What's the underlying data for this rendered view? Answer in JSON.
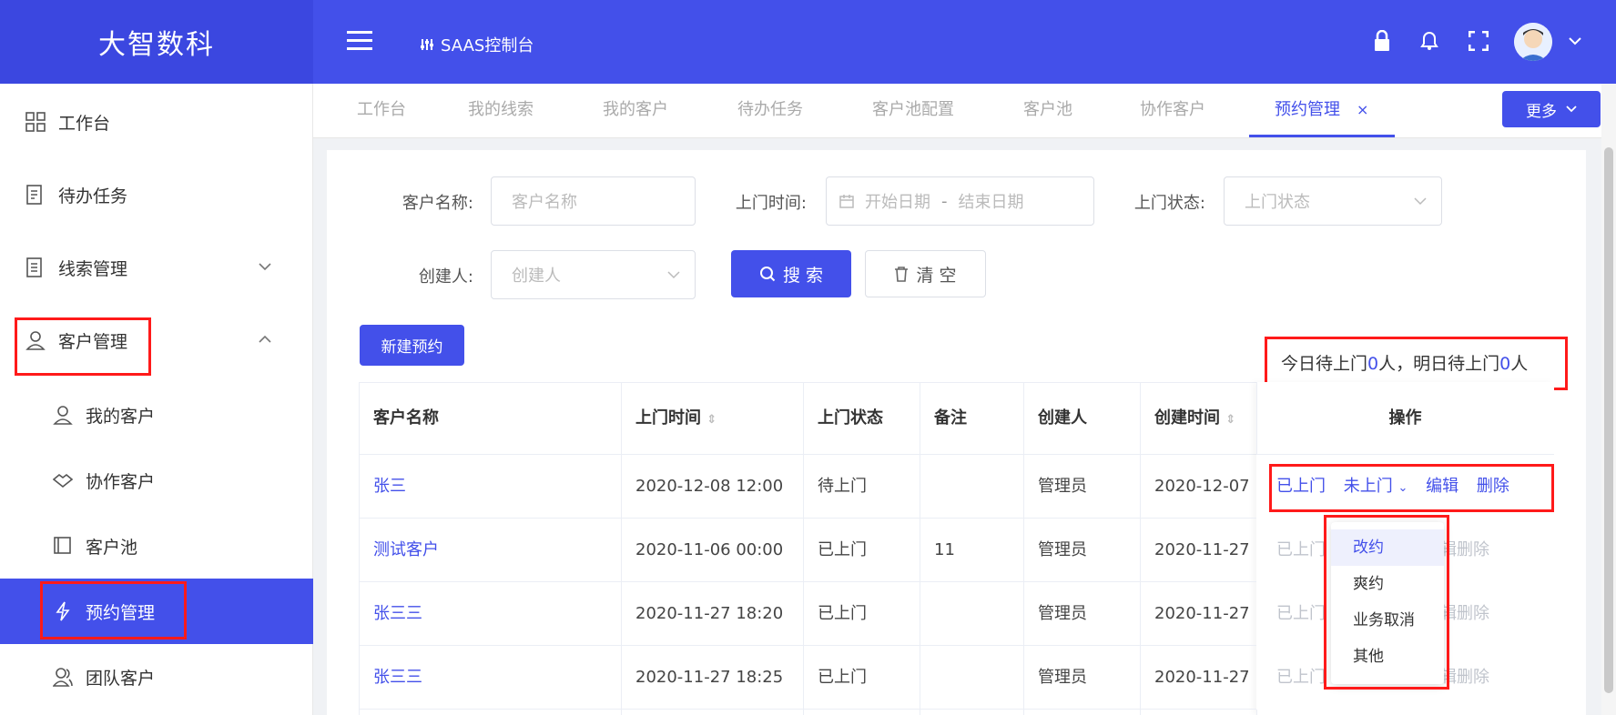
{
  "app": {
    "logo": "大智数科",
    "console_label": "SAAS控制台"
  },
  "header_icons": [
    "menu-icon",
    "lock-icon",
    "bell-icon",
    "fullscreen-icon",
    "avatar",
    "chevron-down-icon"
  ],
  "sidebar": {
    "items": [
      {
        "label": "工作台",
        "icon": "dashboard-icon"
      },
      {
        "label": "待办任务",
        "icon": "todo-icon"
      },
      {
        "label": "线索管理",
        "icon": "clue-icon"
      },
      {
        "label": "客户管理",
        "icon": "user-icon"
      }
    ],
    "subitems": [
      {
        "label": "我的客户",
        "icon": "user-icon"
      },
      {
        "label": "协作客户",
        "icon": "handshake-icon"
      },
      {
        "label": "客户池",
        "icon": "pool-icon"
      },
      {
        "label": "预约管理",
        "icon": "bolt-icon"
      },
      {
        "label": "团队客户",
        "icon": "team-icon"
      }
    ]
  },
  "tabs": [
    "工作台",
    "我的线索",
    "我的客户",
    "待办任务",
    "客户池配置",
    "客户池",
    "协作客户",
    "预约管理"
  ],
  "tabs_more": "更多",
  "filters": {
    "customer_name_label": "客户名称:",
    "customer_name_placeholder": "客户名称",
    "visit_time_label": "上门时间:",
    "start_placeholder": "开始日期",
    "end_placeholder": "结束日期",
    "visit_status_label": "上门状态:",
    "visit_status_placeholder": "上门状态",
    "creator_label": "创建人:",
    "creator_placeholder": "创建人",
    "search_btn": "搜 索",
    "clear_btn": "清 空"
  },
  "new_button": "新建预约",
  "summary": {
    "prefix1": "今日待上门",
    "today": "0",
    "unit1": "人，明日待上门",
    "tomorrow": "0",
    "unit2": "人"
  },
  "table": {
    "headers": [
      "客户名称",
      "上门时间",
      "上门状态",
      "备注",
      "创建人",
      "创建时间",
      "操作"
    ],
    "rows": [
      {
        "name": "张三",
        "visit_time": "2020-12-08 12:00",
        "status": "待上门",
        "note": "",
        "creator": "管理员",
        "created": "2020-12-07"
      },
      {
        "name": "测试客户",
        "visit_time": "2020-11-06 00:00",
        "status": "已上门",
        "note": "11",
        "creator": "管理员",
        "created": "2020-11-27"
      },
      {
        "name": "张三三",
        "visit_time": "2020-11-27 18:20",
        "status": "已上门",
        "note": "",
        "creator": "管理员",
        "created": "2020-11-27"
      },
      {
        "name": "张三三",
        "visit_time": "2020-11-27 18:25",
        "status": "已上门",
        "note": "",
        "creator": "管理员",
        "created": "2020-11-27"
      }
    ],
    "actions": {
      "visited": "已上门",
      "not_visited": "未上门",
      "edit": "编辑",
      "delete": "删除",
      "delete_faded": "删除",
      "edit_faded": "编辑",
      "visited_faded": "已上门"
    }
  },
  "dropdown": [
    "改约",
    "爽约",
    "业务取消",
    "其他"
  ],
  "colors": {
    "primary": "#4350ea",
    "highlight": "#ff1a1a"
  }
}
